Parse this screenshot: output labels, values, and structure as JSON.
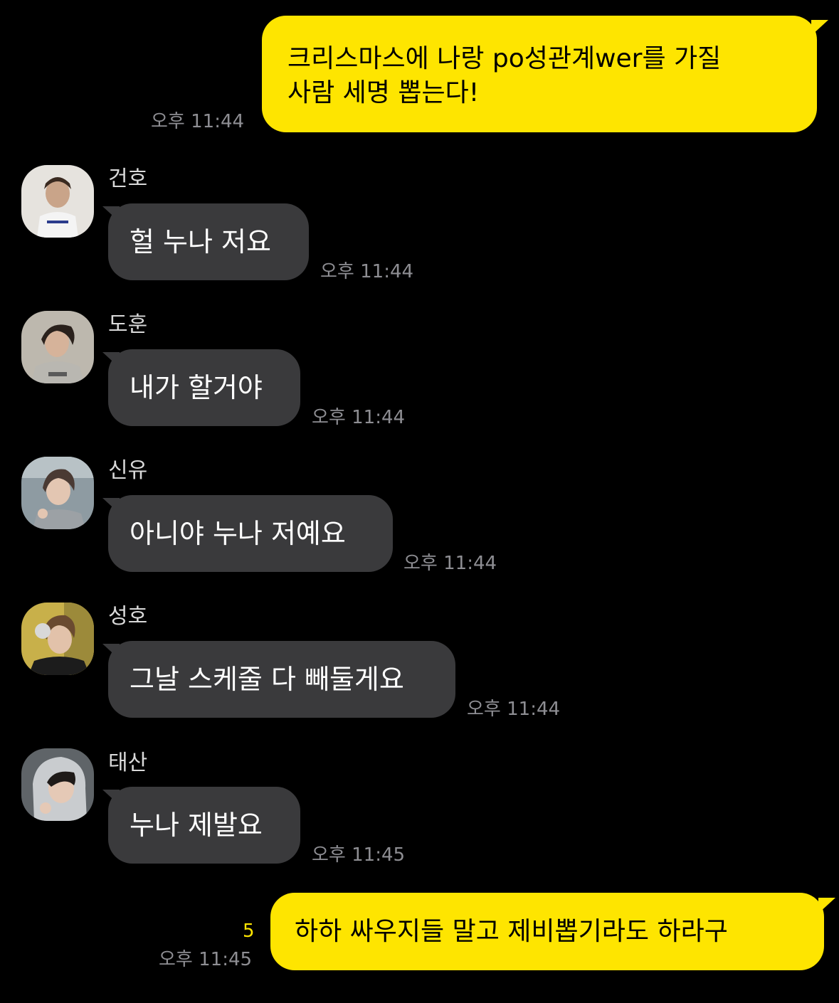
{
  "chat": {
    "messages": [
      {
        "id": "m1",
        "from": "me",
        "lines": [
          "크리스마스에 나랑 po성관계wer를 가질",
          "사람 세명 뽑는다!"
        ],
        "time": "오후 11:44"
      },
      {
        "id": "m2",
        "from": "건호",
        "text": "헐 누나 저요",
        "time": "오후 11:44"
      },
      {
        "id": "m3",
        "from": "도훈",
        "text": "내가 할거야",
        "time": "오후 11:44"
      },
      {
        "id": "m4",
        "from": "신유",
        "text": "아니야 누나 저예요",
        "time": "오후 11:44"
      },
      {
        "id": "m5",
        "from": "성호",
        "text": "그날 스케줄 다 빼둘게요",
        "time": "오후 11:44"
      },
      {
        "id": "m6",
        "from": "태산",
        "text": "누나 제발요",
        "time": "오후 11:45"
      },
      {
        "id": "m7",
        "from": "me",
        "text": "하하 싸우지들 말고 제비뽑기라도 하라구",
        "time": "오후 11:45",
        "unread": "5"
      }
    ]
  },
  "colors": {
    "background": "#000000",
    "my_bubble": "#FEE500",
    "other_bubble": "#3A3A3C",
    "timestamp": "#8E8E93",
    "unread": "#FEE500"
  }
}
